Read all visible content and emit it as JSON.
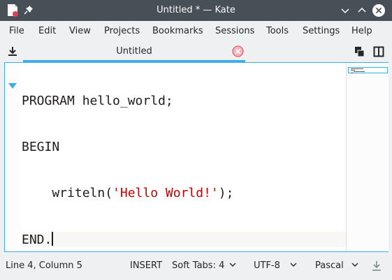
{
  "window": {
    "title": "Untitled * — Kate"
  },
  "menu": [
    "File",
    "Edit",
    "View",
    "Projects",
    "Bookmarks",
    "Sessions",
    "Tools",
    "Settings",
    "Help"
  ],
  "tab": {
    "label": "Untitled"
  },
  "editor": {
    "lines": [
      {
        "text": "PROGRAM hello_world;"
      },
      {
        "text": "BEGIN"
      },
      {
        "pre": "    writeln(",
        "str": "'Hello World!'",
        "post": ");"
      },
      {
        "text": "END."
      }
    ]
  },
  "status": {
    "position": "Line 4, Column 5",
    "mode": "INSERT",
    "indent": "Soft Tabs: 4",
    "encoding": "UTF-8",
    "syntax": "Pascal"
  },
  "colors": {
    "accent": "#3daee9",
    "titlebar": "#475057",
    "string": "#bf0303",
    "close": "#da4453"
  }
}
